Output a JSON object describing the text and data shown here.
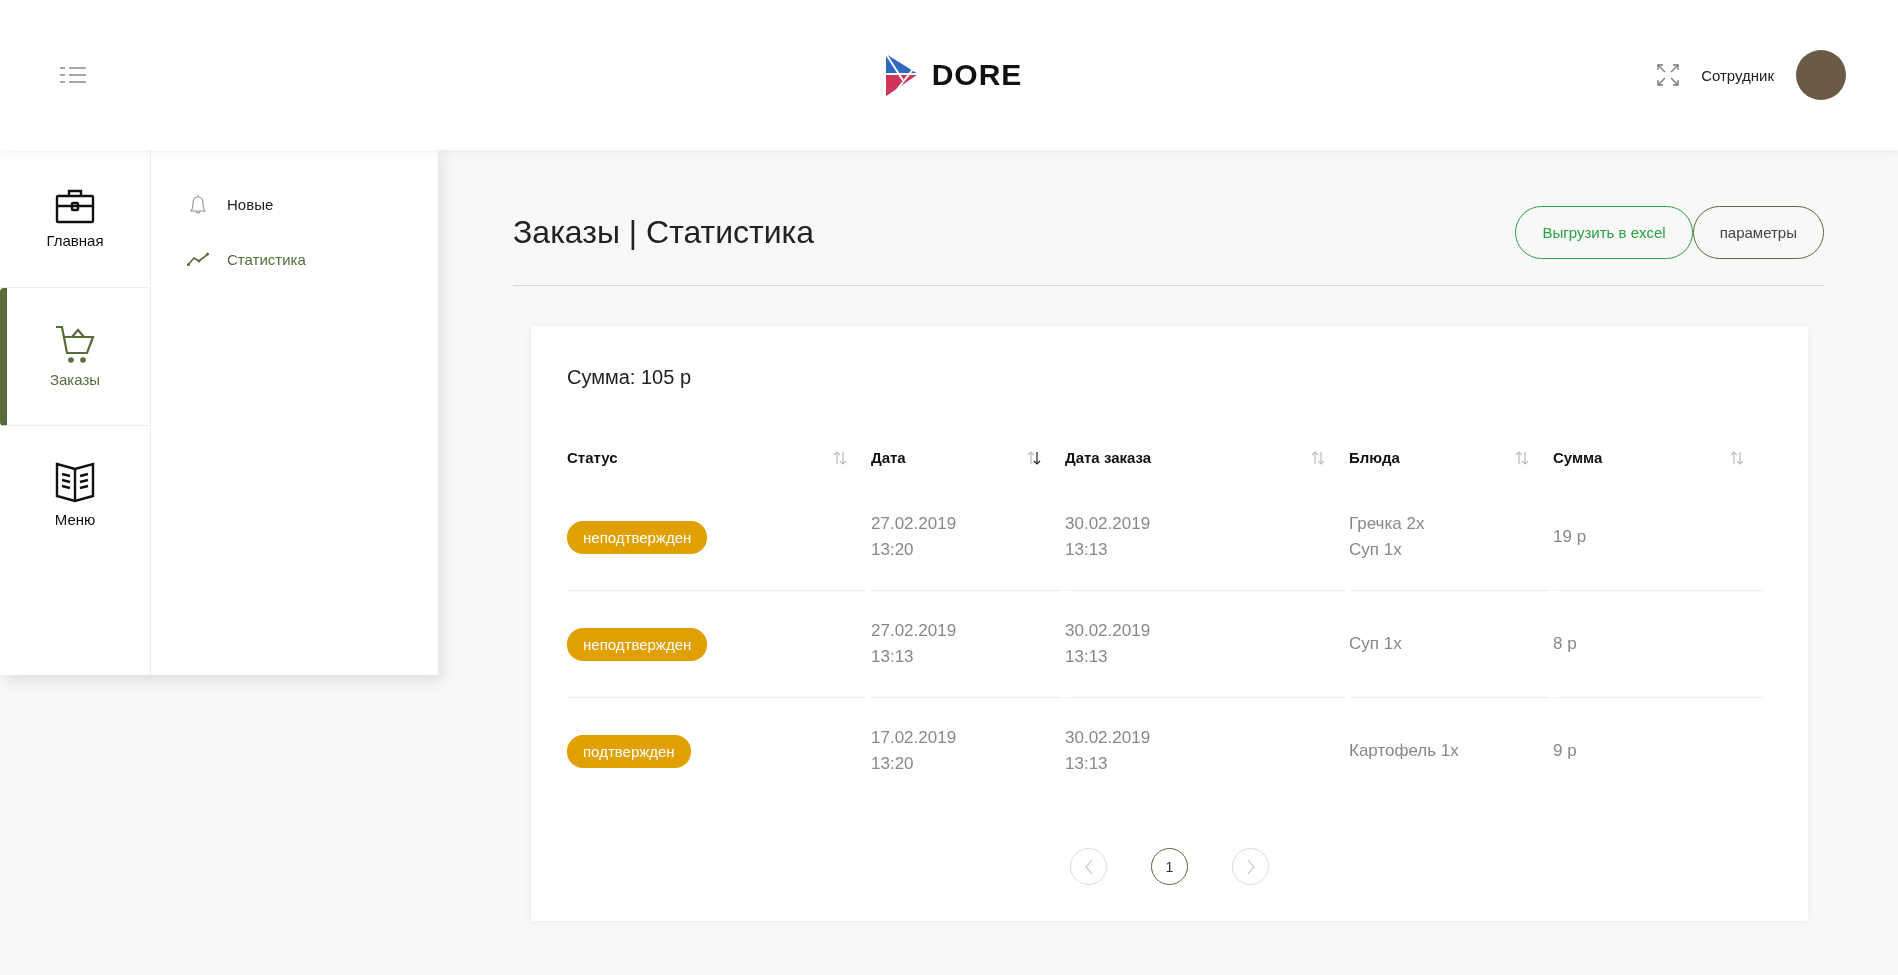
{
  "header": {
    "logo_text": "DORE",
    "user_name": "Сотрудник"
  },
  "sidebar": {
    "items": [
      {
        "label": "Главная",
        "selected": false
      },
      {
        "label": "Заказы",
        "selected": true
      },
      {
        "label": "Меню",
        "selected": false
      }
    ]
  },
  "subnav": {
    "items": [
      {
        "label": "Новые",
        "selected": false
      },
      {
        "label": "Статистика",
        "selected": true
      }
    ]
  },
  "page": {
    "title": "Заказы | Статистика",
    "buttons": [
      {
        "label": "Выгрузить в excel",
        "kind": "export"
      },
      {
        "label": "параметры",
        "kind": "params"
      }
    ]
  },
  "summary": "Сумма: 105 р",
  "table": {
    "columns": [
      {
        "label": "Статус",
        "sorted": false
      },
      {
        "label": "Дата",
        "sorted": true
      },
      {
        "label": "Дата заказа",
        "sorted": false
      },
      {
        "label": "Блюда",
        "sorted": false
      },
      {
        "label": "Сумма",
        "sorted": false
      }
    ],
    "rows": [
      {
        "status": "неподтвержден",
        "date": [
          "27.02.2019",
          "13:20"
        ],
        "order_date": [
          "30.02.2019",
          "13:13"
        ],
        "dishes": [
          "Гречка 2x",
          "Суп 1x"
        ],
        "sum": "19 р"
      },
      {
        "status": "неподтвержден",
        "date": [
          "27.02.2019",
          "13:13"
        ],
        "order_date": [
          "30.02.2019",
          "13:13"
        ],
        "dishes": [
          "Суп 1x"
        ],
        "sum": "8 р"
      },
      {
        "status": "подтвержден",
        "date": [
          "17.02.2019",
          "13:20"
        ],
        "order_date": [
          "30.02.2019",
          "13:13"
        ],
        "dishes": [
          "Картофель 1x"
        ],
        "sum": "9 р"
      }
    ]
  },
  "pagination": {
    "prev_disabled": true,
    "next_disabled": true,
    "pages": [
      {
        "label": "1",
        "selected": true
      }
    ]
  }
}
